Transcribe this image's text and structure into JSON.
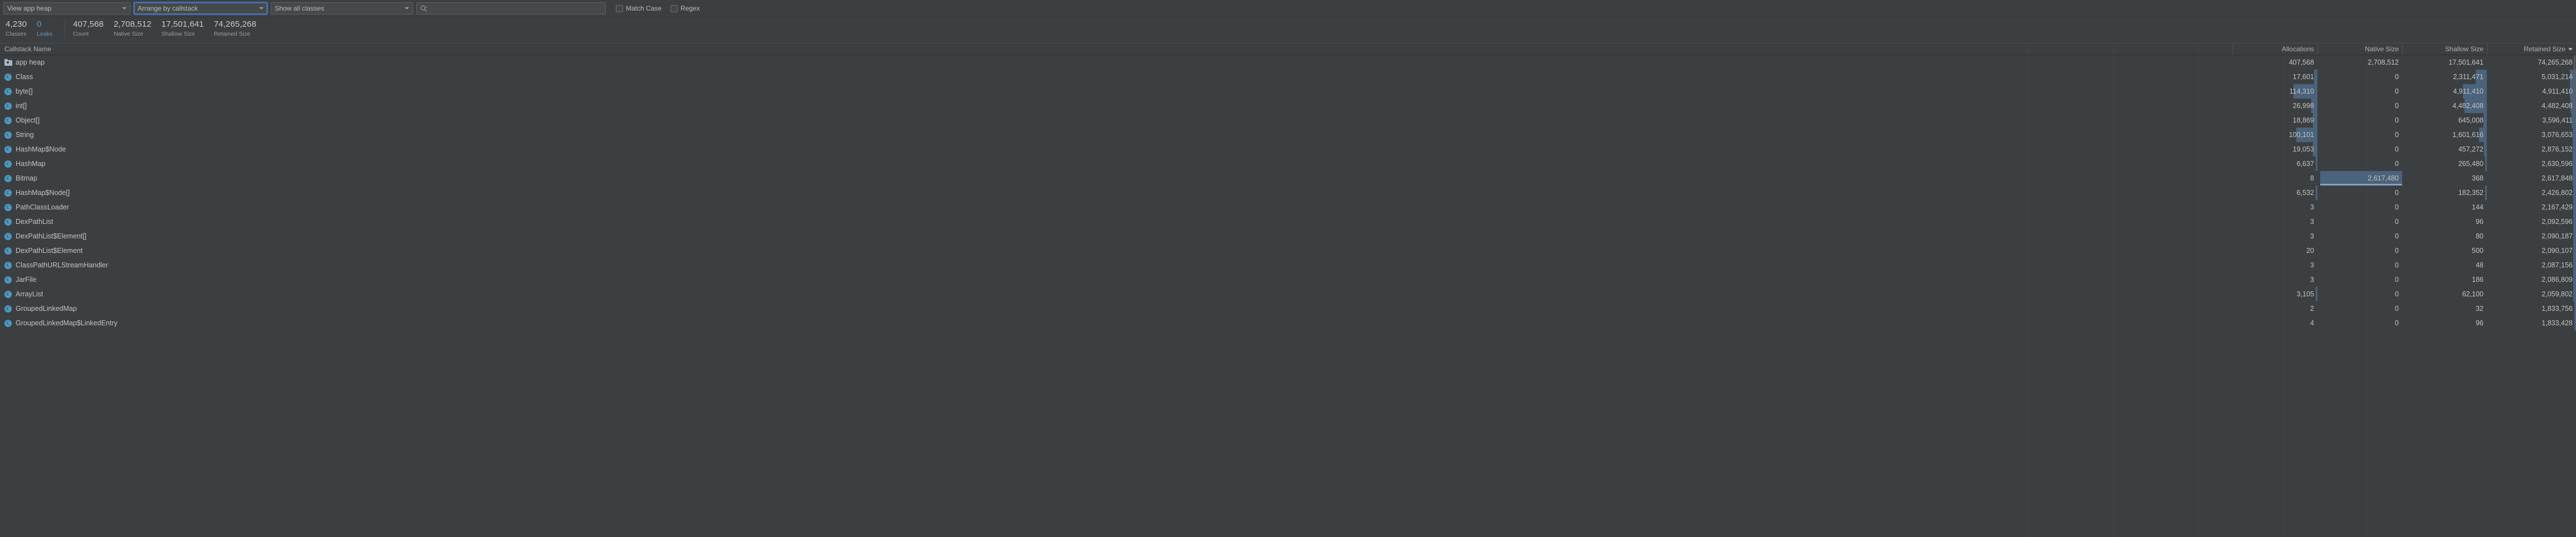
{
  "toolbar": {
    "view_heap": {
      "label": "View app heap",
      "icon": "chevron-down-icon"
    },
    "arrange": {
      "label": "Arrange by callstack",
      "icon": "chevron-down-icon"
    },
    "show_classes": {
      "label": "Show all classes",
      "icon": "chevron-down-icon"
    },
    "search": {
      "value": "",
      "placeholder": "",
      "icon": "search-icon"
    },
    "match_case": {
      "label": "Match Case",
      "checked": false
    },
    "regex": {
      "label": "Regex",
      "checked": false
    }
  },
  "stats": [
    {
      "value": "4,230",
      "label": "Classes",
      "accent": false
    },
    {
      "value": "0",
      "label": "Leaks",
      "accent": true
    },
    {
      "value": "407,568",
      "label": "Count",
      "accent": false
    },
    {
      "value": "2,708,512",
      "label": "Native Size",
      "accent": false
    },
    {
      "value": "17,501,641",
      "label": "Shallow Size",
      "accent": false
    },
    {
      "value": "74,265,268",
      "label": "Retained Size",
      "accent": false
    }
  ],
  "table": {
    "columns": {
      "name": "Callstack Name",
      "allocations": "Allocations",
      "native_size": "Native Size",
      "shallow_size": "Shallow Size",
      "retained_size": "Retained Size"
    },
    "sorted_by": "Retained Size",
    "sort_direction": "desc",
    "rows": [
      {
        "name": "app heap",
        "icon": "heap-folder-icon",
        "depth": 0,
        "allocations": "407,568",
        "native_size": "2,708,512",
        "shallow_size": "17,501,641",
        "retained_size": "74,265,268",
        "bars": {
          "allocations": 0,
          "native_size": 0,
          "shallow_size": 0,
          "retained_size": 0
        }
      },
      {
        "name": "Class",
        "icon": "class-icon",
        "depth": 1,
        "allocations": "17,601",
        "native_size": "0",
        "shallow_size": "2,311,471",
        "retained_size": "5,031,214",
        "bars": {
          "allocations": 4,
          "native_size": 0,
          "shallow_size": 13,
          "retained_size": 7
        }
      },
      {
        "name": "byte[]",
        "icon": "class-icon",
        "depth": 1,
        "allocations": "114,310",
        "native_size": "0",
        "shallow_size": "4,911,410",
        "retained_size": "4,911,410",
        "bars": {
          "allocations": 28,
          "native_size": 0,
          "shallow_size": 28,
          "retained_size": 7
        }
      },
      {
        "name": "int[]",
        "icon": "class-icon",
        "depth": 1,
        "allocations": "26,998",
        "native_size": "0",
        "shallow_size": "4,482,408",
        "retained_size": "4,482,408",
        "bars": {
          "allocations": 7,
          "native_size": 0,
          "shallow_size": 26,
          "retained_size": 6
        }
      },
      {
        "name": "Object[]",
        "icon": "class-icon",
        "depth": 1,
        "allocations": "18,869",
        "native_size": "0",
        "shallow_size": "645,008",
        "retained_size": "3,596,411",
        "bars": {
          "allocations": 5,
          "native_size": 0,
          "shallow_size": 4,
          "retained_size": 5
        }
      },
      {
        "name": "String",
        "icon": "class-icon",
        "depth": 1,
        "allocations": "100,101",
        "native_size": "0",
        "shallow_size": "1,601,616",
        "retained_size": "3,076,653",
        "bars": {
          "allocations": 25,
          "native_size": 0,
          "shallow_size": 9,
          "retained_size": 4
        }
      },
      {
        "name": "HashMap$Node",
        "icon": "class-icon",
        "depth": 1,
        "allocations": "19,053",
        "native_size": "0",
        "shallow_size": "457,272",
        "retained_size": "2,876,152",
        "bars": {
          "allocations": 5,
          "native_size": 0,
          "shallow_size": 3,
          "retained_size": 4
        }
      },
      {
        "name": "HashMap",
        "icon": "class-icon",
        "depth": 1,
        "allocations": "6,637",
        "native_size": "0",
        "shallow_size": "265,480",
        "retained_size": "2,630,596",
        "bars": {
          "allocations": 2,
          "native_size": 0,
          "shallow_size": 2,
          "retained_size": 4
        }
      },
      {
        "name": "Bitmap",
        "icon": "class-icon",
        "depth": 1,
        "allocations": "8",
        "native_size": "2,617,480",
        "shallow_size": "368",
        "retained_size": "2,617,848",
        "bars": {
          "allocations": 0,
          "native_size": 97,
          "shallow_size": 0,
          "retained_size": 4
        }
      },
      {
        "name": "HashMap$Node[]",
        "icon": "class-icon",
        "depth": 1,
        "allocations": "6,532",
        "native_size": "0",
        "shallow_size": "182,352",
        "retained_size": "2,426,802",
        "bars": {
          "allocations": 2,
          "native_size": 0,
          "shallow_size": 1,
          "retained_size": 3
        }
      },
      {
        "name": "PathClassLoader",
        "icon": "class-icon",
        "depth": 1,
        "allocations": "3",
        "native_size": "0",
        "shallow_size": "144",
        "retained_size": "2,167,429",
        "bars": {
          "allocations": 0,
          "native_size": 0,
          "shallow_size": 0,
          "retained_size": 3
        }
      },
      {
        "name": "DexPathList",
        "icon": "class-icon",
        "depth": 1,
        "allocations": "3",
        "native_size": "0",
        "shallow_size": "96",
        "retained_size": "2,092,596",
        "bars": {
          "allocations": 0,
          "native_size": 0,
          "shallow_size": 0,
          "retained_size": 3
        }
      },
      {
        "name": "DexPathList$Element[]",
        "icon": "class-icon",
        "depth": 1,
        "allocations": "3",
        "native_size": "0",
        "shallow_size": "80",
        "retained_size": "2,090,187",
        "bars": {
          "allocations": 0,
          "native_size": 0,
          "shallow_size": 0,
          "retained_size": 3
        }
      },
      {
        "name": "DexPathList$Element",
        "icon": "class-icon",
        "depth": 1,
        "allocations": "20",
        "native_size": "0",
        "shallow_size": "500",
        "retained_size": "2,090,107",
        "bars": {
          "allocations": 0,
          "native_size": 0,
          "shallow_size": 0,
          "retained_size": 3
        }
      },
      {
        "name": "ClassPathURLStreamHandler",
        "icon": "class-icon",
        "depth": 1,
        "allocations": "3",
        "native_size": "0",
        "shallow_size": "48",
        "retained_size": "2,087,156",
        "bars": {
          "allocations": 0,
          "native_size": 0,
          "shallow_size": 0,
          "retained_size": 3
        }
      },
      {
        "name": "JarFile",
        "icon": "class-icon",
        "depth": 1,
        "allocations": "3",
        "native_size": "0",
        "shallow_size": "186",
        "retained_size": "2,086,809",
        "bars": {
          "allocations": 0,
          "native_size": 0,
          "shallow_size": 0,
          "retained_size": 3
        }
      },
      {
        "name": "ArrayList",
        "icon": "class-icon",
        "depth": 1,
        "allocations": "3,105",
        "native_size": "0",
        "shallow_size": "62,100",
        "retained_size": "2,059,802",
        "bars": {
          "allocations": 1,
          "native_size": 0,
          "shallow_size": 0,
          "retained_size": 3
        }
      },
      {
        "name": "GroupedLinkedMap",
        "icon": "class-icon",
        "depth": 1,
        "allocations": "2",
        "native_size": "0",
        "shallow_size": "32",
        "retained_size": "1,833,756",
        "bars": {
          "allocations": 0,
          "native_size": 0,
          "shallow_size": 0,
          "retained_size": 2
        }
      },
      {
        "name": "GroupedLinkedMap$LinkedEntry",
        "icon": "class-icon",
        "depth": 1,
        "allocations": "4",
        "native_size": "0",
        "shallow_size": "96",
        "retained_size": "1,833,428",
        "bars": {
          "allocations": 0,
          "native_size": 0,
          "shallow_size": 0,
          "retained_size": 2
        }
      }
    ]
  }
}
